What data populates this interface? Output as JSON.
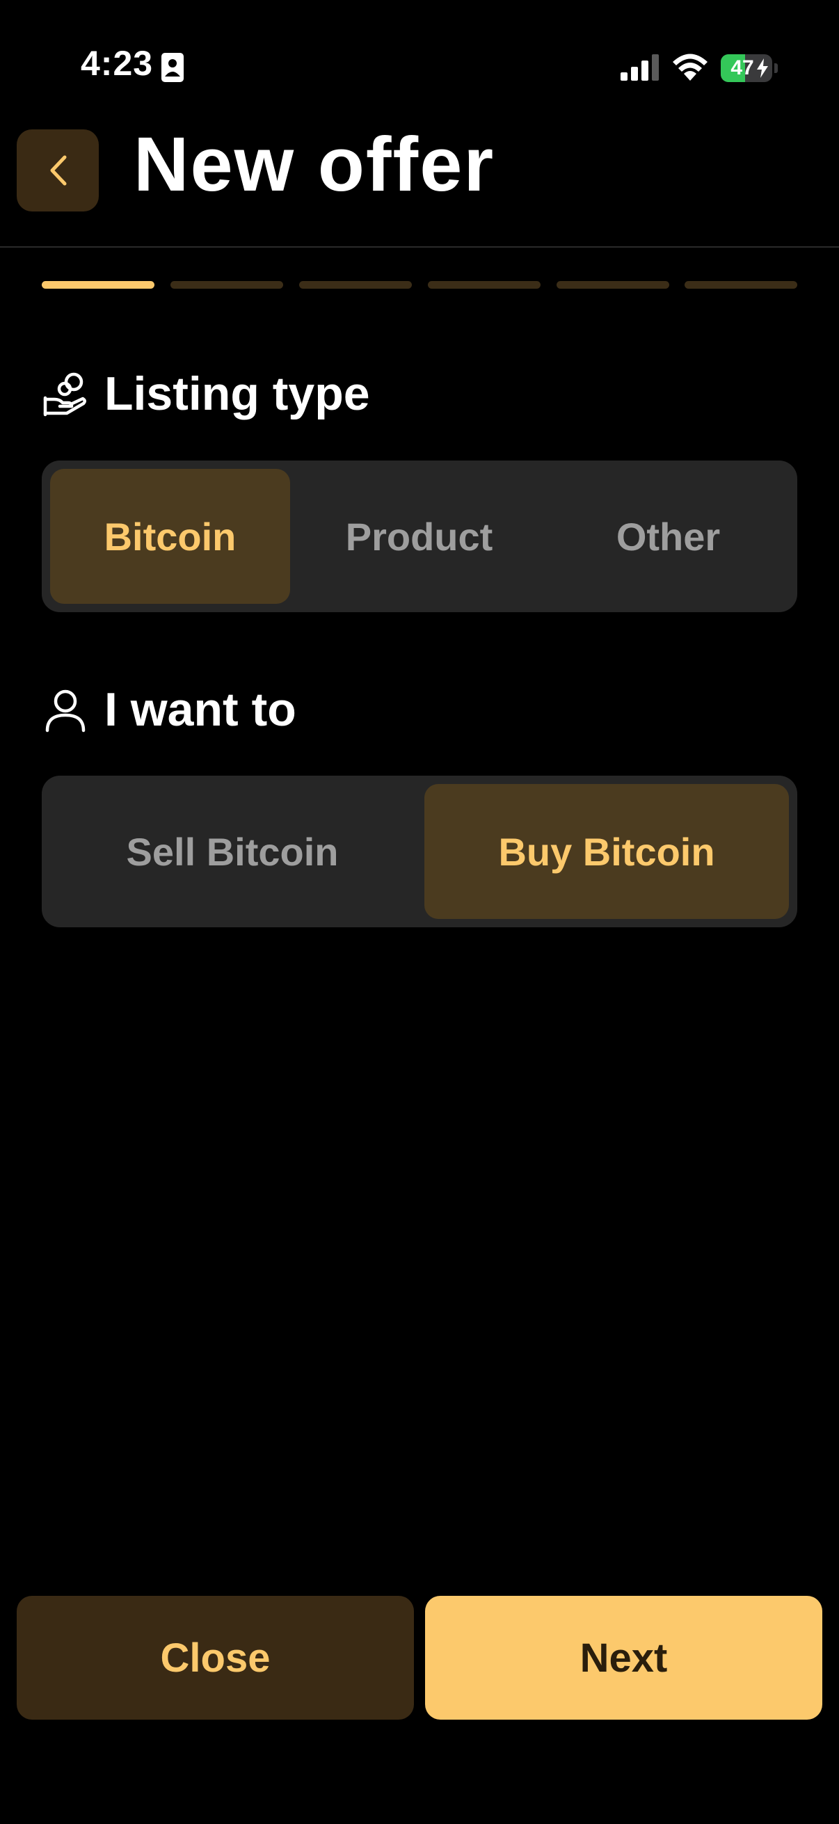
{
  "status_bar": {
    "time": "4:23",
    "battery_level": "47",
    "battery_percent": 47,
    "icons": [
      "id-card-icon",
      "cellular-signal-icon",
      "wifi-icon",
      "battery-charging-icon"
    ]
  },
  "header": {
    "title": "New offer",
    "back_icon": "chevron-left-icon"
  },
  "progress": {
    "total_steps": 6,
    "current_step": 1
  },
  "listing_type": {
    "title": "Listing type",
    "icon": "hand-coins-icon",
    "options": [
      "Bitcoin",
      "Product",
      "Other"
    ],
    "selected": "Bitcoin"
  },
  "intent": {
    "title": "I want to",
    "icon": "user-icon",
    "options": [
      "Sell Bitcoin",
      "Buy Bitcoin"
    ],
    "selected": "Buy Bitcoin"
  },
  "footer": {
    "close_label": "Close",
    "next_label": "Next"
  },
  "colors": {
    "background": "#000000",
    "accent": "#fcc96c",
    "accent_muted": "#4b3b1f",
    "button_dark": "#3a2a14",
    "segment_bg": "#262626",
    "progress_inactive": "#3b2d17",
    "battery_green": "#34c759"
  }
}
